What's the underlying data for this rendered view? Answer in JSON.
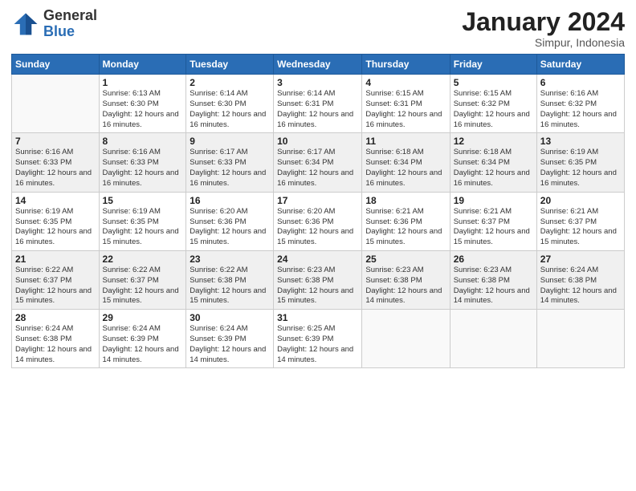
{
  "header": {
    "logo_general": "General",
    "logo_blue": "Blue",
    "month_title": "January 2024",
    "subtitle": "Simpur, Indonesia"
  },
  "weekdays": [
    "Sunday",
    "Monday",
    "Tuesday",
    "Wednesday",
    "Thursday",
    "Friday",
    "Saturday"
  ],
  "weeks": [
    [
      {
        "day": "",
        "sunrise": "",
        "sunset": "",
        "daylight": ""
      },
      {
        "day": "1",
        "sunrise": "Sunrise: 6:13 AM",
        "sunset": "Sunset: 6:30 PM",
        "daylight": "Daylight: 12 hours and 16 minutes."
      },
      {
        "day": "2",
        "sunrise": "Sunrise: 6:14 AM",
        "sunset": "Sunset: 6:30 PM",
        "daylight": "Daylight: 12 hours and 16 minutes."
      },
      {
        "day": "3",
        "sunrise": "Sunrise: 6:14 AM",
        "sunset": "Sunset: 6:31 PM",
        "daylight": "Daylight: 12 hours and 16 minutes."
      },
      {
        "day": "4",
        "sunrise": "Sunrise: 6:15 AM",
        "sunset": "Sunset: 6:31 PM",
        "daylight": "Daylight: 12 hours and 16 minutes."
      },
      {
        "day": "5",
        "sunrise": "Sunrise: 6:15 AM",
        "sunset": "Sunset: 6:32 PM",
        "daylight": "Daylight: 12 hours and 16 minutes."
      },
      {
        "day": "6",
        "sunrise": "Sunrise: 6:16 AM",
        "sunset": "Sunset: 6:32 PM",
        "daylight": "Daylight: 12 hours and 16 minutes."
      }
    ],
    [
      {
        "day": "7",
        "sunrise": "Sunrise: 6:16 AM",
        "sunset": "Sunset: 6:33 PM",
        "daylight": "Daylight: 12 hours and 16 minutes."
      },
      {
        "day": "8",
        "sunrise": "Sunrise: 6:16 AM",
        "sunset": "Sunset: 6:33 PM",
        "daylight": "Daylight: 12 hours and 16 minutes."
      },
      {
        "day": "9",
        "sunrise": "Sunrise: 6:17 AM",
        "sunset": "Sunset: 6:33 PM",
        "daylight": "Daylight: 12 hours and 16 minutes."
      },
      {
        "day": "10",
        "sunrise": "Sunrise: 6:17 AM",
        "sunset": "Sunset: 6:34 PM",
        "daylight": "Daylight: 12 hours and 16 minutes."
      },
      {
        "day": "11",
        "sunrise": "Sunrise: 6:18 AM",
        "sunset": "Sunset: 6:34 PM",
        "daylight": "Daylight: 12 hours and 16 minutes."
      },
      {
        "day": "12",
        "sunrise": "Sunrise: 6:18 AM",
        "sunset": "Sunset: 6:34 PM",
        "daylight": "Daylight: 12 hours and 16 minutes."
      },
      {
        "day": "13",
        "sunrise": "Sunrise: 6:19 AM",
        "sunset": "Sunset: 6:35 PM",
        "daylight": "Daylight: 12 hours and 16 minutes."
      }
    ],
    [
      {
        "day": "14",
        "sunrise": "Sunrise: 6:19 AM",
        "sunset": "Sunset: 6:35 PM",
        "daylight": "Daylight: 12 hours and 16 minutes."
      },
      {
        "day": "15",
        "sunrise": "Sunrise: 6:19 AM",
        "sunset": "Sunset: 6:35 PM",
        "daylight": "Daylight: 12 hours and 15 minutes."
      },
      {
        "day": "16",
        "sunrise": "Sunrise: 6:20 AM",
        "sunset": "Sunset: 6:36 PM",
        "daylight": "Daylight: 12 hours and 15 minutes."
      },
      {
        "day": "17",
        "sunrise": "Sunrise: 6:20 AM",
        "sunset": "Sunset: 6:36 PM",
        "daylight": "Daylight: 12 hours and 15 minutes."
      },
      {
        "day": "18",
        "sunrise": "Sunrise: 6:21 AM",
        "sunset": "Sunset: 6:36 PM",
        "daylight": "Daylight: 12 hours and 15 minutes."
      },
      {
        "day": "19",
        "sunrise": "Sunrise: 6:21 AM",
        "sunset": "Sunset: 6:37 PM",
        "daylight": "Daylight: 12 hours and 15 minutes."
      },
      {
        "day": "20",
        "sunrise": "Sunrise: 6:21 AM",
        "sunset": "Sunset: 6:37 PM",
        "daylight": "Daylight: 12 hours and 15 minutes."
      }
    ],
    [
      {
        "day": "21",
        "sunrise": "Sunrise: 6:22 AM",
        "sunset": "Sunset: 6:37 PM",
        "daylight": "Daylight: 12 hours and 15 minutes."
      },
      {
        "day": "22",
        "sunrise": "Sunrise: 6:22 AM",
        "sunset": "Sunset: 6:37 PM",
        "daylight": "Daylight: 12 hours and 15 minutes."
      },
      {
        "day": "23",
        "sunrise": "Sunrise: 6:22 AM",
        "sunset": "Sunset: 6:38 PM",
        "daylight": "Daylight: 12 hours and 15 minutes."
      },
      {
        "day": "24",
        "sunrise": "Sunrise: 6:23 AM",
        "sunset": "Sunset: 6:38 PM",
        "daylight": "Daylight: 12 hours and 15 minutes."
      },
      {
        "day": "25",
        "sunrise": "Sunrise: 6:23 AM",
        "sunset": "Sunset: 6:38 PM",
        "daylight": "Daylight: 12 hours and 14 minutes."
      },
      {
        "day": "26",
        "sunrise": "Sunrise: 6:23 AM",
        "sunset": "Sunset: 6:38 PM",
        "daylight": "Daylight: 12 hours and 14 minutes."
      },
      {
        "day": "27",
        "sunrise": "Sunrise: 6:24 AM",
        "sunset": "Sunset: 6:38 PM",
        "daylight": "Daylight: 12 hours and 14 minutes."
      }
    ],
    [
      {
        "day": "28",
        "sunrise": "Sunrise: 6:24 AM",
        "sunset": "Sunset: 6:38 PM",
        "daylight": "Daylight: 12 hours and 14 minutes."
      },
      {
        "day": "29",
        "sunrise": "Sunrise: 6:24 AM",
        "sunset": "Sunset: 6:39 PM",
        "daylight": "Daylight: 12 hours and 14 minutes."
      },
      {
        "day": "30",
        "sunrise": "Sunrise: 6:24 AM",
        "sunset": "Sunset: 6:39 PM",
        "daylight": "Daylight: 12 hours and 14 minutes."
      },
      {
        "day": "31",
        "sunrise": "Sunrise: 6:25 AM",
        "sunset": "Sunset: 6:39 PM",
        "daylight": "Daylight: 12 hours and 14 minutes."
      },
      {
        "day": "",
        "sunrise": "",
        "sunset": "",
        "daylight": ""
      },
      {
        "day": "",
        "sunrise": "",
        "sunset": "",
        "daylight": ""
      },
      {
        "day": "",
        "sunrise": "",
        "sunset": "",
        "daylight": ""
      }
    ]
  ]
}
